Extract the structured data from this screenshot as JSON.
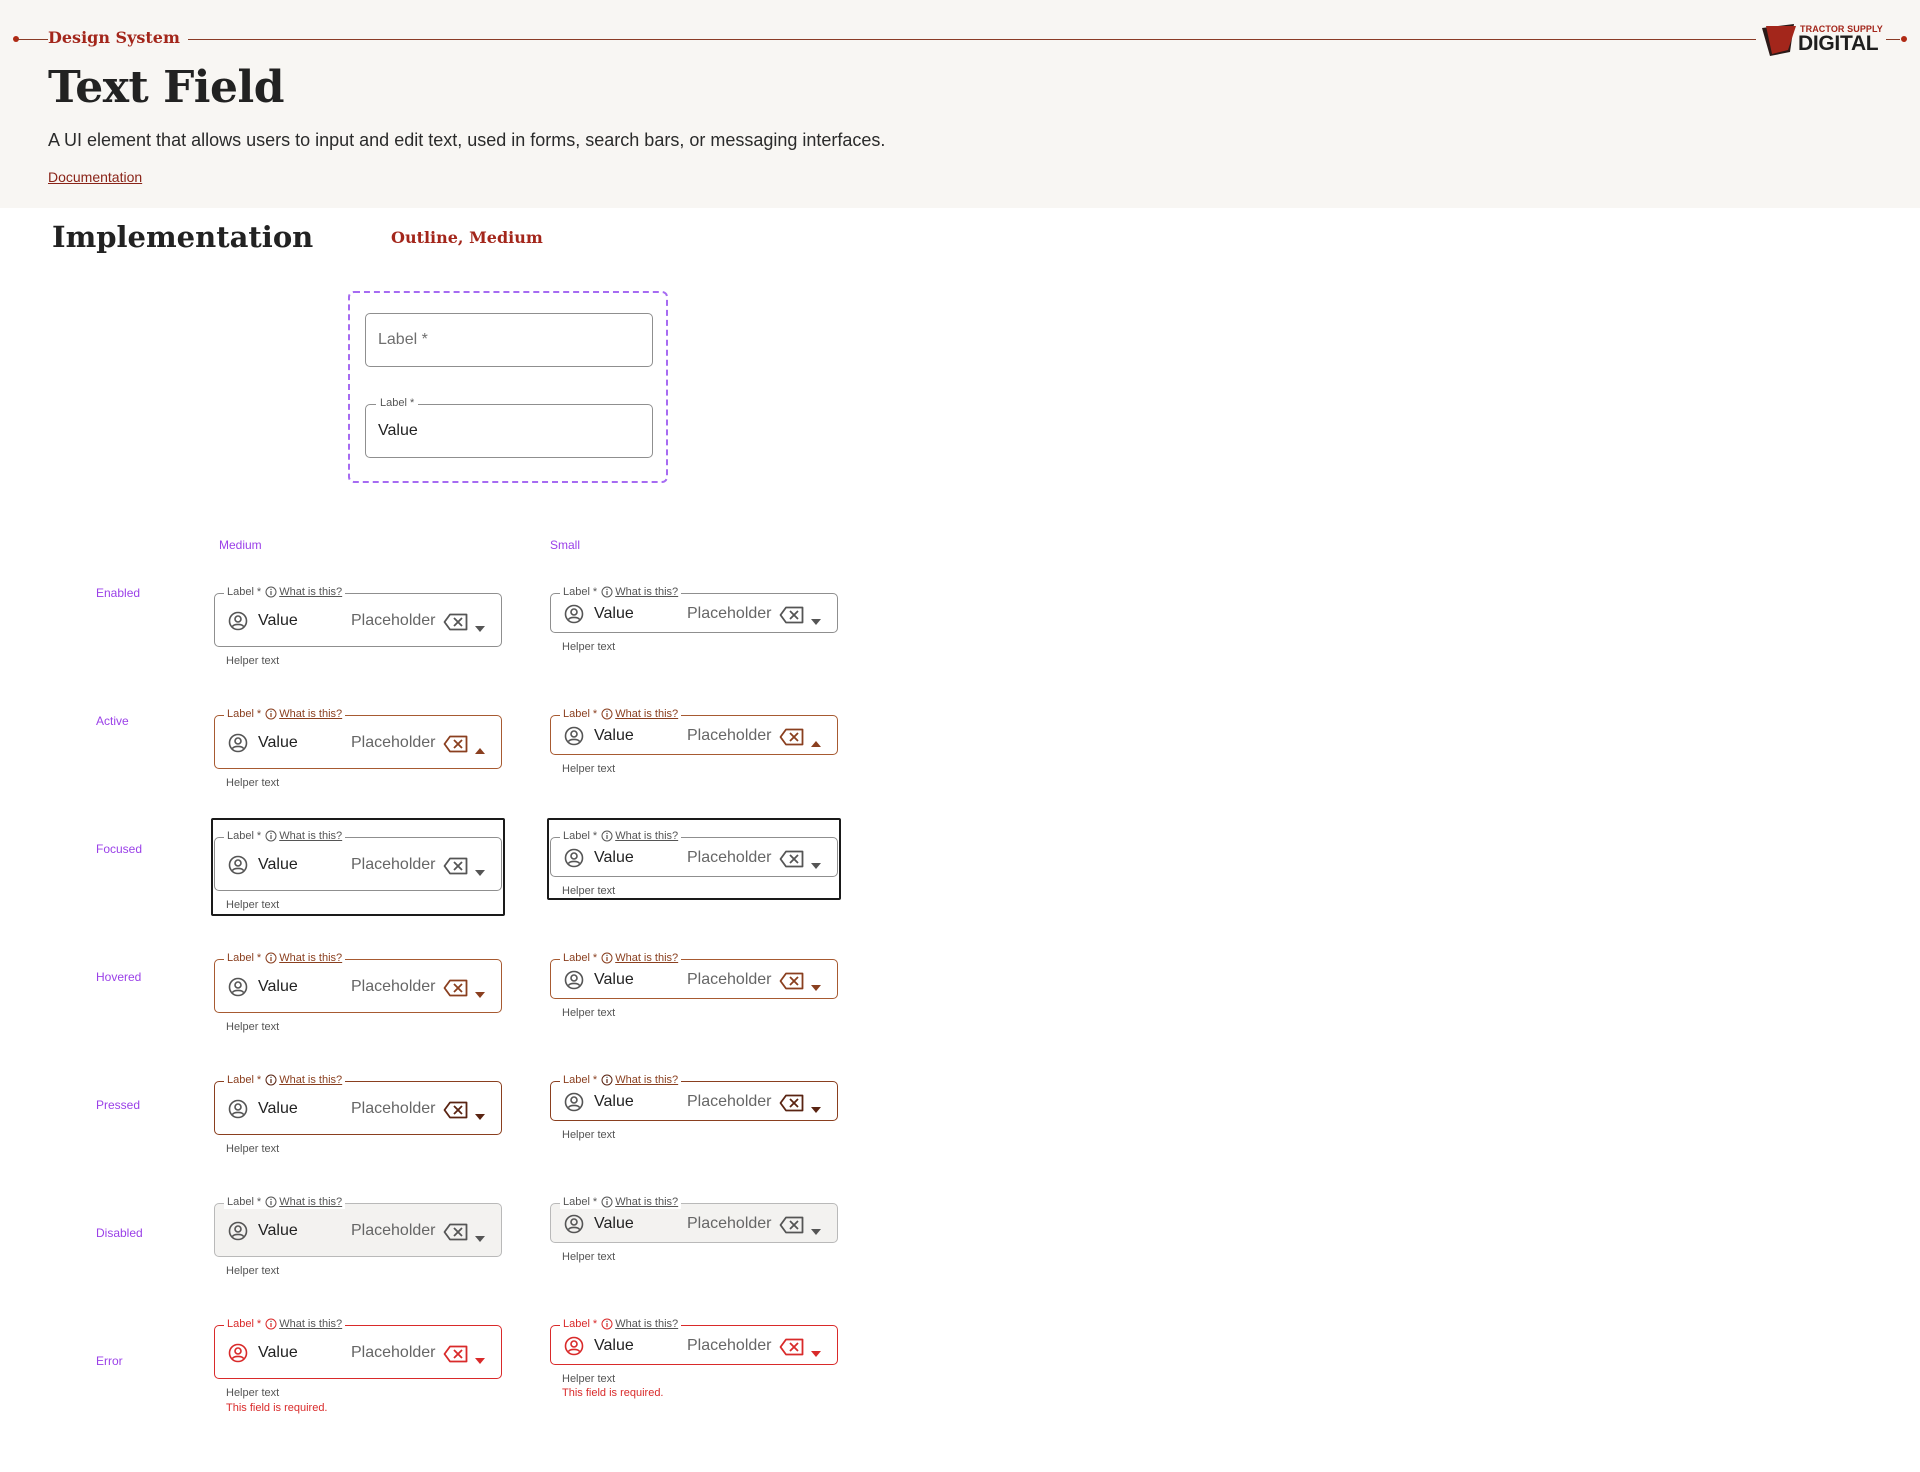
{
  "header": {
    "section_label": "Design System",
    "title": "Text Field",
    "description": "A UI element that allows users to input and edit text, used in forms, search bars, or messaging interfaces.",
    "doc_link": "Documentation",
    "logo_top": "TRACTOR SUPPLY",
    "logo_bottom": "DIGITAL"
  },
  "implementation": {
    "title": "Implementation",
    "variant": "Outline, Medium",
    "demo": {
      "empty_label": "Label *",
      "filled_label": "Label *",
      "filled_value": "Value"
    }
  },
  "columns": {
    "medium": "Medium",
    "small": "Small"
  },
  "field": {
    "label": "Label",
    "required_mark": "*",
    "info_link": "What is this?",
    "value": "Value",
    "placeholder": "Placeholder",
    "helper": "Helper text",
    "error_message": "This field is required."
  },
  "states": {
    "enabled": "Enabled",
    "active": "Active",
    "focused": "Focused",
    "hovered": "Hovered",
    "pressed": "Pressed",
    "disabled": "Disabled",
    "error": "Error"
  },
  "colors": {
    "brand_red": "#a3261b",
    "state_label_purple": "#9b41e8",
    "active_brown": "#a75a31",
    "error_red": "#d92a2a",
    "header_bg": "#f8f6f3"
  },
  "icons": [
    "user-circle-icon",
    "info-icon",
    "clear-icon",
    "chevron-down-icon",
    "chevron-up-icon"
  ]
}
